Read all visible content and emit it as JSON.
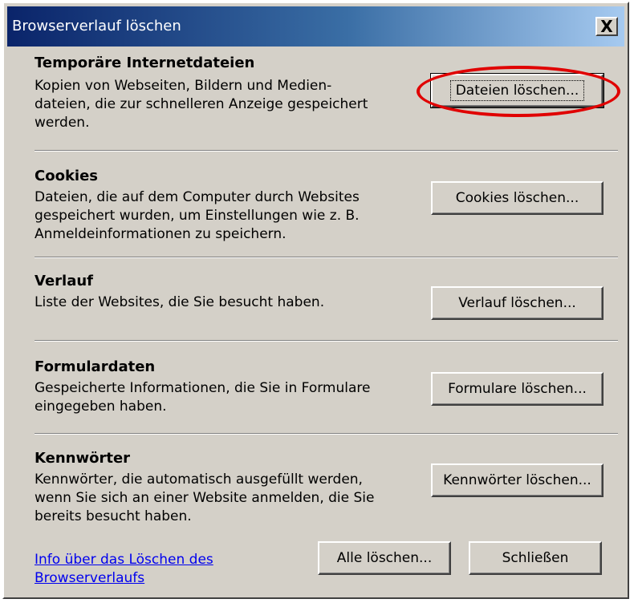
{
  "window": {
    "title": "Browserverlauf löschen",
    "close_label": "X"
  },
  "sections": [
    {
      "title": "Temporäre Internetdateien",
      "desc_lines": [
        "Kopien von Webseiten, Bildern und Medien-",
        "dateien, die zur schnelleren Anzeige gespeichert",
        "werden."
      ],
      "button": "Dateien löschen..."
    },
    {
      "title": "Cookies",
      "desc_lines": [
        "Dateien, die auf dem Computer durch Websites",
        "gespeichert wurden, um Einstellungen wie z. B.",
        "Anmeldeinformationen zu speichern."
      ],
      "button": "Cookies löschen..."
    },
    {
      "title": "Verlauf",
      "desc_lines": [
        "Liste der Websites, die Sie besucht haben."
      ],
      "button": "Verlauf löschen..."
    },
    {
      "title": "Formulardaten",
      "desc_lines": [
        "Gespeicherte Informationen, die Sie in Formulare",
        "eingegeben haben."
      ],
      "button": "Formulare löschen..."
    },
    {
      "title": "Kennwörter",
      "desc_lines": [
        "Kennwörter, die automatisch ausgefüllt werden,",
        "wenn Sie sich an einer Website anmelden, die Sie",
        "bereits besucht haben."
      ],
      "button": "Kennwörter löschen..."
    }
  ],
  "footer": {
    "info_link_lines": [
      "Info über das Löschen des",
      "Browserverlaufs"
    ],
    "delete_all_button": "Alle löschen...",
    "close_button": "Schließen"
  },
  "colors": {
    "dialog_bg": "#d4d0c8",
    "titlebar_start": "#0a246a",
    "titlebar_end": "#a6caf0",
    "annotation_circle": "#e00000",
    "link": "#0000ee"
  }
}
